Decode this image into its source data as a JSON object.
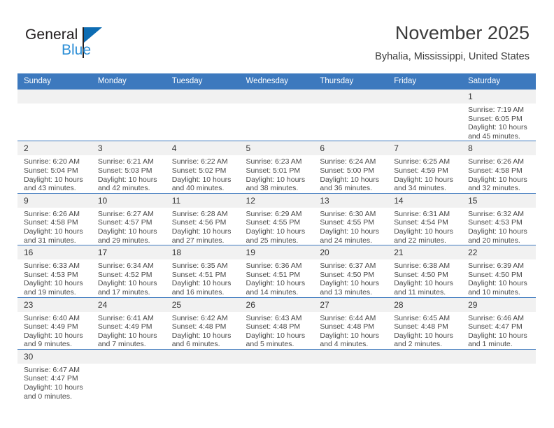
{
  "brand": {
    "name_part1": "General",
    "name_part2": "Blue",
    "flag_color": "#0d6cb3",
    "blue_color": "#2b8ed6"
  },
  "header": {
    "title": "November 2025",
    "location": "Byhalia, Mississippi, United States"
  },
  "theme": {
    "header_blue": "#3d79be",
    "daynum_band": "#f1f1f1",
    "text": "#333333"
  },
  "calendar": {
    "weekday_headers": [
      "Sunday",
      "Monday",
      "Tuesday",
      "Wednesday",
      "Thursday",
      "Friday",
      "Saturday"
    ],
    "weeks": [
      [
        {
          "day": "",
          "empty": true
        },
        {
          "day": "",
          "empty": true
        },
        {
          "day": "",
          "empty": true
        },
        {
          "day": "",
          "empty": true
        },
        {
          "day": "",
          "empty": true
        },
        {
          "day": "",
          "empty": true
        },
        {
          "day": "1",
          "sunrise": "Sunrise: 7:19 AM",
          "sunset": "Sunset: 6:05 PM",
          "daylight": "Daylight: 10 hours and 45 minutes."
        }
      ],
      [
        {
          "day": "2",
          "sunrise": "Sunrise: 6:20 AM",
          "sunset": "Sunset: 5:04 PM",
          "daylight": "Daylight: 10 hours and 43 minutes."
        },
        {
          "day": "3",
          "sunrise": "Sunrise: 6:21 AM",
          "sunset": "Sunset: 5:03 PM",
          "daylight": "Daylight: 10 hours and 42 minutes."
        },
        {
          "day": "4",
          "sunrise": "Sunrise: 6:22 AM",
          "sunset": "Sunset: 5:02 PM",
          "daylight": "Daylight: 10 hours and 40 minutes."
        },
        {
          "day": "5",
          "sunrise": "Sunrise: 6:23 AM",
          "sunset": "Sunset: 5:01 PM",
          "daylight": "Daylight: 10 hours and 38 minutes."
        },
        {
          "day": "6",
          "sunrise": "Sunrise: 6:24 AM",
          "sunset": "Sunset: 5:00 PM",
          "daylight": "Daylight: 10 hours and 36 minutes."
        },
        {
          "day": "7",
          "sunrise": "Sunrise: 6:25 AM",
          "sunset": "Sunset: 4:59 PM",
          "daylight": "Daylight: 10 hours and 34 minutes."
        },
        {
          "day": "8",
          "sunrise": "Sunrise: 6:26 AM",
          "sunset": "Sunset: 4:58 PM",
          "daylight": "Daylight: 10 hours and 32 minutes."
        }
      ],
      [
        {
          "day": "9",
          "sunrise": "Sunrise: 6:26 AM",
          "sunset": "Sunset: 4:58 PM",
          "daylight": "Daylight: 10 hours and 31 minutes."
        },
        {
          "day": "10",
          "sunrise": "Sunrise: 6:27 AM",
          "sunset": "Sunset: 4:57 PM",
          "daylight": "Daylight: 10 hours and 29 minutes."
        },
        {
          "day": "11",
          "sunrise": "Sunrise: 6:28 AM",
          "sunset": "Sunset: 4:56 PM",
          "daylight": "Daylight: 10 hours and 27 minutes."
        },
        {
          "day": "12",
          "sunrise": "Sunrise: 6:29 AM",
          "sunset": "Sunset: 4:55 PM",
          "daylight": "Daylight: 10 hours and 25 minutes."
        },
        {
          "day": "13",
          "sunrise": "Sunrise: 6:30 AM",
          "sunset": "Sunset: 4:55 PM",
          "daylight": "Daylight: 10 hours and 24 minutes."
        },
        {
          "day": "14",
          "sunrise": "Sunrise: 6:31 AM",
          "sunset": "Sunset: 4:54 PM",
          "daylight": "Daylight: 10 hours and 22 minutes."
        },
        {
          "day": "15",
          "sunrise": "Sunrise: 6:32 AM",
          "sunset": "Sunset: 4:53 PM",
          "daylight": "Daylight: 10 hours and 20 minutes."
        }
      ],
      [
        {
          "day": "16",
          "sunrise": "Sunrise: 6:33 AM",
          "sunset": "Sunset: 4:53 PM",
          "daylight": "Daylight: 10 hours and 19 minutes."
        },
        {
          "day": "17",
          "sunrise": "Sunrise: 6:34 AM",
          "sunset": "Sunset: 4:52 PM",
          "daylight": "Daylight: 10 hours and 17 minutes."
        },
        {
          "day": "18",
          "sunrise": "Sunrise: 6:35 AM",
          "sunset": "Sunset: 4:51 PM",
          "daylight": "Daylight: 10 hours and 16 minutes."
        },
        {
          "day": "19",
          "sunrise": "Sunrise: 6:36 AM",
          "sunset": "Sunset: 4:51 PM",
          "daylight": "Daylight: 10 hours and 14 minutes."
        },
        {
          "day": "20",
          "sunrise": "Sunrise: 6:37 AM",
          "sunset": "Sunset: 4:50 PM",
          "daylight": "Daylight: 10 hours and 13 minutes."
        },
        {
          "day": "21",
          "sunrise": "Sunrise: 6:38 AM",
          "sunset": "Sunset: 4:50 PM",
          "daylight": "Daylight: 10 hours and 11 minutes."
        },
        {
          "day": "22",
          "sunrise": "Sunrise: 6:39 AM",
          "sunset": "Sunset: 4:50 PM",
          "daylight": "Daylight: 10 hours and 10 minutes."
        }
      ],
      [
        {
          "day": "23",
          "sunrise": "Sunrise: 6:40 AM",
          "sunset": "Sunset: 4:49 PM",
          "daylight": "Daylight: 10 hours and 9 minutes."
        },
        {
          "day": "24",
          "sunrise": "Sunrise: 6:41 AM",
          "sunset": "Sunset: 4:49 PM",
          "daylight": "Daylight: 10 hours and 7 minutes."
        },
        {
          "day": "25",
          "sunrise": "Sunrise: 6:42 AM",
          "sunset": "Sunset: 4:48 PM",
          "daylight": "Daylight: 10 hours and 6 minutes."
        },
        {
          "day": "26",
          "sunrise": "Sunrise: 6:43 AM",
          "sunset": "Sunset: 4:48 PM",
          "daylight": "Daylight: 10 hours and 5 minutes."
        },
        {
          "day": "27",
          "sunrise": "Sunrise: 6:44 AM",
          "sunset": "Sunset: 4:48 PM",
          "daylight": "Daylight: 10 hours and 4 minutes."
        },
        {
          "day": "28",
          "sunrise": "Sunrise: 6:45 AM",
          "sunset": "Sunset: 4:48 PM",
          "daylight": "Daylight: 10 hours and 2 minutes."
        },
        {
          "day": "29",
          "sunrise": "Sunrise: 6:46 AM",
          "sunset": "Sunset: 4:47 PM",
          "daylight": "Daylight: 10 hours and 1 minute."
        }
      ],
      [
        {
          "day": "30",
          "sunrise": "Sunrise: 6:47 AM",
          "sunset": "Sunset: 4:47 PM",
          "daylight": "Daylight: 10 hours and 0 minutes."
        },
        {
          "day": "",
          "empty": true
        },
        {
          "day": "",
          "empty": true
        },
        {
          "day": "",
          "empty": true
        },
        {
          "day": "",
          "empty": true
        },
        {
          "day": "",
          "empty": true
        },
        {
          "day": "",
          "empty": true
        }
      ]
    ]
  }
}
